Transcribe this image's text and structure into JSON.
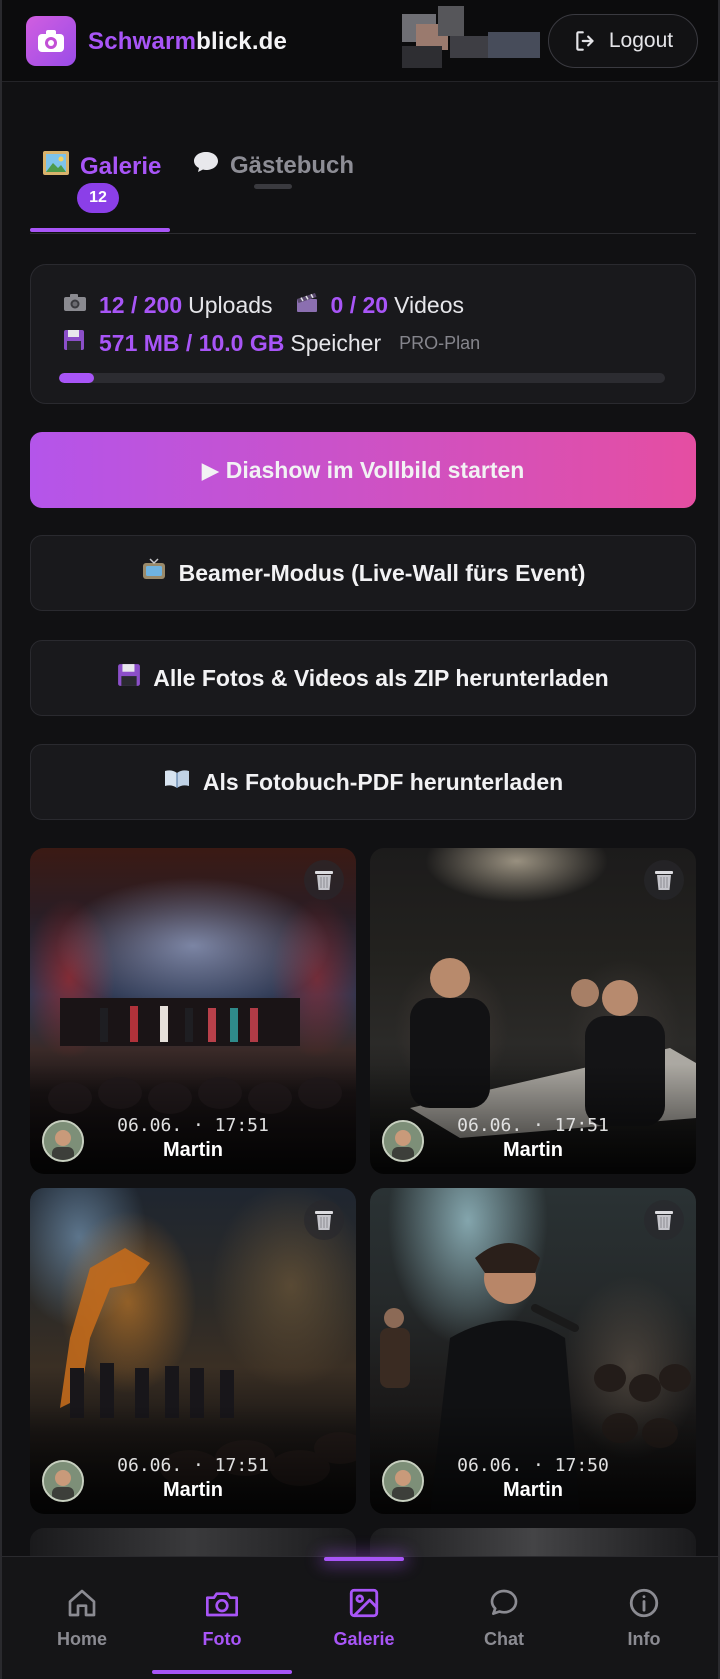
{
  "header": {
    "brand_part1": "Schwarm",
    "brand_part2": "blick.de",
    "logout_label": "Logout"
  },
  "tabs": {
    "galerie_label": "Galerie",
    "galerie_count": "12",
    "gaestebuch_label": "Gästebuch"
  },
  "stats": {
    "uploads_value": "12 / 200",
    "uploads_label": "Uploads",
    "videos_value": "0 / 20",
    "videos_label": "Videos",
    "storage_value": "571 MB / 10.0 GB",
    "storage_label": "Speicher",
    "plan": "PRO-Plan",
    "storage_fraction": 0.057
  },
  "buttons": {
    "slideshow": "▶ Diashow im Vollbild starten",
    "beamer": "Beamer-Modus (Live-Wall fürs Event)",
    "zip": "Alle Fotos & Videos als ZIP herunterladen",
    "pdf": "Als Fotobuch-PDF herunterladen"
  },
  "gallery": [
    {
      "time": "06.06. · 17:51",
      "author": "Martin"
    },
    {
      "time": "06.06. · 17:51",
      "author": "Martin"
    },
    {
      "time": "06.06. · 17:51",
      "author": "Martin"
    },
    {
      "time": "06.06. · 17:50",
      "author": "Martin"
    }
  ],
  "nav": {
    "home": "Home",
    "foto": "Foto",
    "galerie": "Galerie",
    "chat": "Chat",
    "info": "Info"
  },
  "colors": {
    "accent": "#a855f7",
    "gradient_start": "#b455ea",
    "gradient_end": "#e54ea2"
  }
}
